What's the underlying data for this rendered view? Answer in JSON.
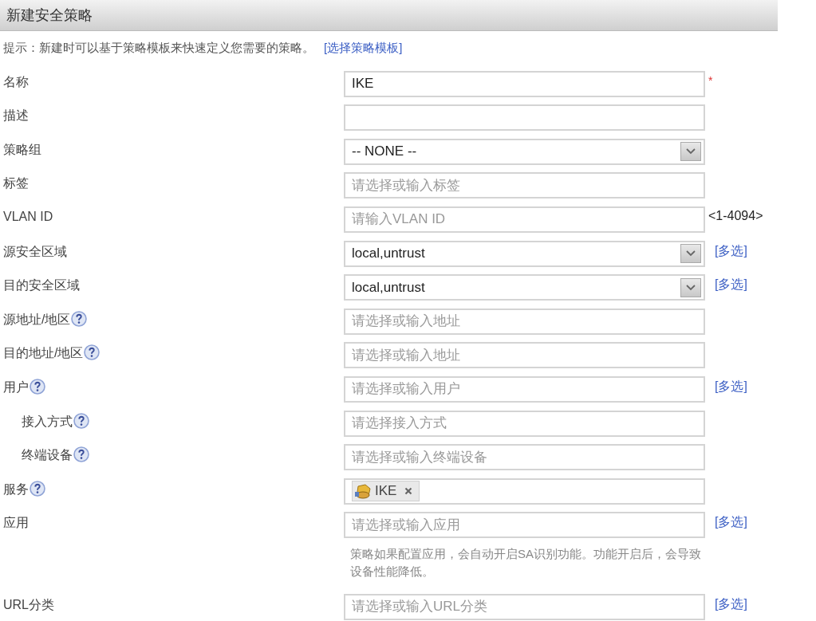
{
  "title": "新建安全策略",
  "hint": {
    "text": "提示：新建时可以基于策略模板来快速定义您需要的策略。",
    "link": "[选择策略模板]"
  },
  "rows": [
    {
      "label": "名称",
      "help": false,
      "indent": false,
      "field": {
        "kind": "text",
        "value": "IKE"
      },
      "suffix": {
        "kind": "required",
        "text": "*"
      }
    },
    {
      "label": "描述",
      "help": false,
      "indent": false,
      "field": {
        "kind": "text"
      }
    },
    {
      "label": "策略组",
      "help": false,
      "indent": false,
      "field": {
        "kind": "select",
        "value": "-- NONE --"
      }
    },
    {
      "label": "标签",
      "help": false,
      "indent": false,
      "field": {
        "kind": "text",
        "placeholder": "请选择或输入标签"
      }
    },
    {
      "label": "VLAN ID",
      "help": false,
      "indent": false,
      "field": {
        "kind": "text",
        "placeholder": "请输入VLAN ID"
      },
      "suffix": {
        "kind": "range",
        "text": "<1-4094>"
      }
    },
    {
      "label": "源安全区域",
      "help": false,
      "indent": false,
      "field": {
        "kind": "select",
        "value": "local,untrust"
      },
      "suffix": {
        "kind": "link",
        "text": "[多选]"
      }
    },
    {
      "label": "目的安全区域",
      "help": false,
      "indent": false,
      "field": {
        "kind": "select",
        "value": "local,untrust"
      },
      "suffix": {
        "kind": "link",
        "text": "[多选]"
      }
    },
    {
      "label": "源地址/地区",
      "help": true,
      "indent": false,
      "field": {
        "kind": "text",
        "placeholder": "请选择或输入地址"
      }
    },
    {
      "label": "目的地址/地区",
      "help": true,
      "indent": false,
      "field": {
        "kind": "text",
        "placeholder": "请选择或输入地址"
      }
    },
    {
      "label": "用户",
      "help": true,
      "indent": false,
      "field": {
        "kind": "text",
        "placeholder": "请选择或输入用户"
      },
      "suffix": {
        "kind": "link",
        "text": "[多选]"
      }
    },
    {
      "label": "接入方式",
      "help": true,
      "indent": true,
      "field": {
        "kind": "text",
        "placeholder": "请选择接入方式"
      }
    },
    {
      "label": "终端设备",
      "help": true,
      "indent": true,
      "field": {
        "kind": "text",
        "placeholder": "请选择或输入终端设备"
      }
    },
    {
      "label": "服务",
      "help": true,
      "indent": false,
      "field": {
        "kind": "tags",
        "tags": [
          "IKE"
        ]
      }
    },
    {
      "label": "应用",
      "help": false,
      "indent": false,
      "field": {
        "kind": "text",
        "placeholder": "请选择或输入应用"
      },
      "suffix": {
        "kind": "link",
        "text": "[多选]"
      },
      "note": "策略如果配置应用，会自动开启SA识别功能。功能开启后，会导致设备性能降低。"
    },
    {
      "label": "URL分类",
      "help": false,
      "indent": false,
      "field": {
        "kind": "text",
        "placeholder": "请选择或输入URL分类"
      },
      "suffix": {
        "kind": "link",
        "text": "[多选]"
      }
    }
  ]
}
